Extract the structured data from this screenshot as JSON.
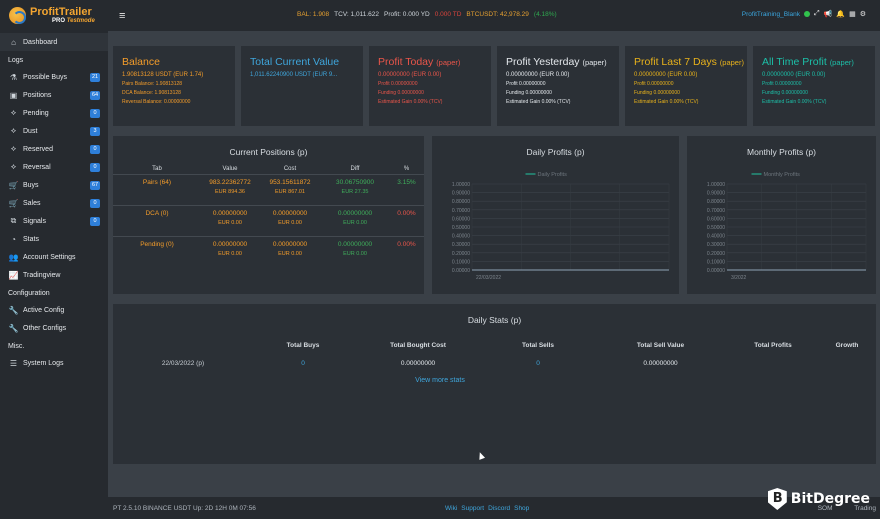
{
  "app": {
    "logo_name": "ProfitTrailer",
    "logo_sub_a": "PRO",
    "logo_sub_b": "Testmode"
  },
  "topbar": {
    "bal_label": "BAL: 1.908",
    "tcv_label": "TCV: 1,011.622",
    "profit_label": "Profit: 0.000 YD",
    "td_label": "0.000 TD",
    "btc_label": "BTCUSDT: 42,978.29",
    "btc_change": "(4.18%)",
    "username": "ProfitTraining_Blank"
  },
  "sidebar": {
    "dashboard": "Dashboard",
    "logs_header": "Logs",
    "items": [
      {
        "label": "Possible Buys",
        "icon": "flask-icon",
        "badge": "21"
      },
      {
        "label": "Positions",
        "icon": "briefcase-icon",
        "badge": "64"
      },
      {
        "label": "Pending",
        "icon": "handshake-icon",
        "badge": "0"
      },
      {
        "label": "Dust",
        "icon": "handshake-icon",
        "badge": "3"
      },
      {
        "label": "Reserved",
        "icon": "handshake-icon",
        "badge": "0"
      },
      {
        "label": "Reversal",
        "icon": "handshake-icon",
        "badge": "0"
      },
      {
        "label": "Buys",
        "icon": "cart-icon",
        "badge": "67"
      },
      {
        "label": "Sales",
        "icon": "cart-icon",
        "badge": "0"
      },
      {
        "label": "Signals",
        "icon": "signal-icon",
        "badge": "0"
      },
      {
        "label": "Stats",
        "icon": "pie-icon",
        "badge": ""
      },
      {
        "label": "Account Settings",
        "icon": "users-icon",
        "badge": ""
      },
      {
        "label": "Tradingview",
        "icon": "chart-icon",
        "badge": ""
      }
    ],
    "config_header": "Configuration",
    "config_items": [
      "Active Config",
      "Other Configs"
    ],
    "misc_header": "Misc.",
    "misc_items": [
      "System Logs"
    ]
  },
  "stats": [
    {
      "title": "Balance",
      "paper": "",
      "main": "1.90813128 USDT (EUR 1.74)",
      "lines": [
        "Pairs Balance: 1.90813128",
        "DCA Balance: 1.90813128",
        "Reversal Balance: 0.00000000"
      ],
      "color": "#f39c2a"
    },
    {
      "title": "Total Current Value",
      "paper": "",
      "main": "1,011.62240900 USDT (EUR 9...",
      "lines": [],
      "color": "#3fa6dc"
    },
    {
      "title": "Profit Today",
      "paper": "(paper)",
      "main": "0.00000000 (EUR 0.00)",
      "lines": [
        "Profit 0.00000000",
        "Funding 0.00000000",
        "Estimated Gain 0.00% (TCV)"
      ],
      "color": "#e9554a"
    },
    {
      "title": "Profit Yesterday",
      "paper": "(paper)",
      "main": "0.00000000 (EUR 0.00)",
      "lines": [
        "Profit 0.00000000",
        "Funding 0.00000000",
        "Estimated Gain 0.00% (TCV)"
      ],
      "color": "#e4e8ec"
    },
    {
      "title": "Profit Last 7 Days",
      "paper": "(paper)",
      "main": "0.00000000 (EUR 0.00)",
      "lines": [
        "Profit 0.00000000",
        "Funding 0.00000000",
        "Estimated Gain 0.00% (TCV)"
      ],
      "color": "#e8b21b"
    },
    {
      "title": "All Time Profit",
      "paper": "(paper)",
      "main": "0.00000000 (EUR 0.00)",
      "lines": [
        "Profit 0.00000000",
        "Funding 0.00000000",
        "Estimated Gain 0.00% (TCV)"
      ],
      "color": "#1cbfa8"
    }
  ],
  "positions": {
    "title": "Current Positions (p)",
    "headers": [
      "Tab",
      "Value",
      "Cost",
      "Diff",
      "%"
    ],
    "rows": [
      {
        "tab": "Pairs (64)",
        "value": "983.22362772",
        "value_eur": "EUR 894.36",
        "cost": "953.15611872",
        "cost_eur": "EUR 867.01",
        "diff": "30.06750900",
        "diff_eur": "EUR 27.35",
        "pct": "3.15%",
        "pct_color": "#3fae5b"
      },
      {
        "tab": "DCA (0)",
        "value": "0.00000000",
        "value_eur": "EUR 0.00",
        "cost": "0.00000000",
        "cost_eur": "EUR 0.00",
        "diff": "0.00000000",
        "diff_eur": "EUR 0.00",
        "pct": "0.00%",
        "pct_color": "#e9554a"
      },
      {
        "tab": "Pending (0)",
        "value": "0.00000000",
        "value_eur": "EUR 0.00",
        "cost": "0.00000000",
        "cost_eur": "EUR 0.00",
        "diff": "0.00000000",
        "diff_eur": "EUR 0.00",
        "pct": "0.00%",
        "pct_color": "#e9554a"
      }
    ]
  },
  "chart_data": [
    {
      "type": "line",
      "title": "Daily Profits (p)",
      "series": [
        {
          "name": "Daily Profits",
          "values": [
            0
          ]
        }
      ],
      "x": [
        "22/03/2022"
      ],
      "ylim": [
        0,
        1
      ],
      "yticks": [
        "1.00000",
        "0.90000",
        "0.80000",
        "0.70000",
        "0.60000",
        "0.50000",
        "0.40000",
        "0.30000",
        "0.20000",
        "0.10000",
        "0.00000"
      ]
    },
    {
      "type": "line",
      "title": "Monthly Profits (p)",
      "series": [
        {
          "name": "Monthly Profits",
          "values": [
            0
          ]
        }
      ],
      "x": [
        "3/2022"
      ],
      "ylim": [
        0,
        1
      ],
      "yticks": [
        "1.00000",
        "0.90000",
        "0.80000",
        "0.70000",
        "0.60000",
        "0.50000",
        "0.40000",
        "0.30000",
        "0.20000",
        "0.10000",
        "0.00000"
      ]
    }
  ],
  "daily_stats": {
    "title": "Daily Stats (p)",
    "headers": [
      "",
      "Total Buys",
      "Total Bought Cost",
      "Total Sells",
      "Total Sell Value",
      "Total Profits",
      "Growth"
    ],
    "row": [
      "22/03/2022 (p)",
      "0",
      "0.00000000",
      "0",
      "0.00000000",
      "",
      ""
    ],
    "view_more": "View more stats"
  },
  "footer": {
    "left": "PT 2.5.10  BINANCE USDT  Up: 2D 12H 0M  07:56",
    "links": [
      "Wiki",
      "Support",
      "Discord",
      "Shop"
    ],
    "right_a": "SOM",
    "right_b": "Trading"
  },
  "watermark": "BitDegree"
}
